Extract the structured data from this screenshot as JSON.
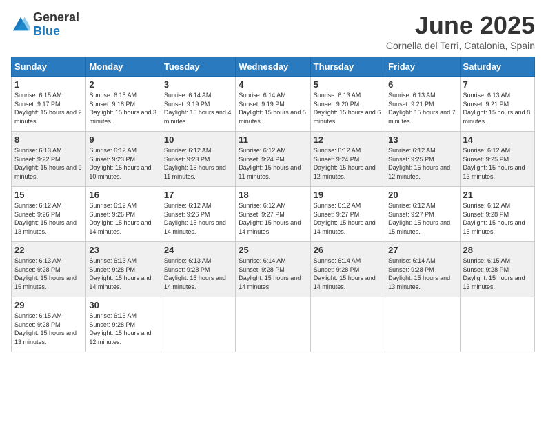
{
  "logo": {
    "general": "General",
    "blue": "Blue"
  },
  "title": "June 2025",
  "subtitle": "Cornella del Terri, Catalonia, Spain",
  "days": [
    "Sunday",
    "Monday",
    "Tuesday",
    "Wednesday",
    "Thursday",
    "Friday",
    "Saturday"
  ],
  "weeks": [
    [
      {
        "day": "1",
        "sunrise": "6:15 AM",
        "sunset": "9:17 PM",
        "daylight": "15 hours and 2 minutes."
      },
      {
        "day": "2",
        "sunrise": "6:15 AM",
        "sunset": "9:18 PM",
        "daylight": "15 hours and 3 minutes."
      },
      {
        "day": "3",
        "sunrise": "6:14 AM",
        "sunset": "9:19 PM",
        "daylight": "15 hours and 4 minutes."
      },
      {
        "day": "4",
        "sunrise": "6:14 AM",
        "sunset": "9:19 PM",
        "daylight": "15 hours and 5 minutes."
      },
      {
        "day": "5",
        "sunrise": "6:13 AM",
        "sunset": "9:20 PM",
        "daylight": "15 hours and 6 minutes."
      },
      {
        "day": "6",
        "sunrise": "6:13 AM",
        "sunset": "9:21 PM",
        "daylight": "15 hours and 7 minutes."
      },
      {
        "day": "7",
        "sunrise": "6:13 AM",
        "sunset": "9:21 PM",
        "daylight": "15 hours and 8 minutes."
      }
    ],
    [
      {
        "day": "8",
        "sunrise": "6:13 AM",
        "sunset": "9:22 PM",
        "daylight": "15 hours and 9 minutes."
      },
      {
        "day": "9",
        "sunrise": "6:12 AM",
        "sunset": "9:23 PM",
        "daylight": "15 hours and 10 minutes."
      },
      {
        "day": "10",
        "sunrise": "6:12 AM",
        "sunset": "9:23 PM",
        "daylight": "15 hours and 11 minutes."
      },
      {
        "day": "11",
        "sunrise": "6:12 AM",
        "sunset": "9:24 PM",
        "daylight": "15 hours and 11 minutes."
      },
      {
        "day": "12",
        "sunrise": "6:12 AM",
        "sunset": "9:24 PM",
        "daylight": "15 hours and 12 minutes."
      },
      {
        "day": "13",
        "sunrise": "6:12 AM",
        "sunset": "9:25 PM",
        "daylight": "15 hours and 12 minutes."
      },
      {
        "day": "14",
        "sunrise": "6:12 AM",
        "sunset": "9:25 PM",
        "daylight": "15 hours and 13 minutes."
      }
    ],
    [
      {
        "day": "15",
        "sunrise": "6:12 AM",
        "sunset": "9:26 PM",
        "daylight": "15 hours and 13 minutes."
      },
      {
        "day": "16",
        "sunrise": "6:12 AM",
        "sunset": "9:26 PM",
        "daylight": "15 hours and 14 minutes."
      },
      {
        "day": "17",
        "sunrise": "6:12 AM",
        "sunset": "9:26 PM",
        "daylight": "15 hours and 14 minutes."
      },
      {
        "day": "18",
        "sunrise": "6:12 AM",
        "sunset": "9:27 PM",
        "daylight": "15 hours and 14 minutes."
      },
      {
        "day": "19",
        "sunrise": "6:12 AM",
        "sunset": "9:27 PM",
        "daylight": "15 hours and 14 minutes."
      },
      {
        "day": "20",
        "sunrise": "6:12 AM",
        "sunset": "9:27 PM",
        "daylight": "15 hours and 15 minutes."
      },
      {
        "day": "21",
        "sunrise": "6:12 AM",
        "sunset": "9:28 PM",
        "daylight": "15 hours and 15 minutes."
      }
    ],
    [
      {
        "day": "22",
        "sunrise": "6:13 AM",
        "sunset": "9:28 PM",
        "daylight": "15 hours and 15 minutes."
      },
      {
        "day": "23",
        "sunrise": "6:13 AM",
        "sunset": "9:28 PM",
        "daylight": "15 hours and 14 minutes."
      },
      {
        "day": "24",
        "sunrise": "6:13 AM",
        "sunset": "9:28 PM",
        "daylight": "15 hours and 14 minutes."
      },
      {
        "day": "25",
        "sunrise": "6:14 AM",
        "sunset": "9:28 PM",
        "daylight": "15 hours and 14 minutes."
      },
      {
        "day": "26",
        "sunrise": "6:14 AM",
        "sunset": "9:28 PM",
        "daylight": "15 hours and 14 minutes."
      },
      {
        "day": "27",
        "sunrise": "6:14 AM",
        "sunset": "9:28 PM",
        "daylight": "15 hours and 13 minutes."
      },
      {
        "day": "28",
        "sunrise": "6:15 AM",
        "sunset": "9:28 PM",
        "daylight": "15 hours and 13 minutes."
      }
    ],
    [
      {
        "day": "29",
        "sunrise": "6:15 AM",
        "sunset": "9:28 PM",
        "daylight": "15 hours and 13 minutes."
      },
      {
        "day": "30",
        "sunrise": "6:16 AM",
        "sunset": "9:28 PM",
        "daylight": "15 hours and 12 minutes."
      },
      null,
      null,
      null,
      null,
      null
    ]
  ],
  "labels": {
    "sunrise": "Sunrise:",
    "sunset": "Sunset:",
    "daylight": "Daylight:"
  }
}
